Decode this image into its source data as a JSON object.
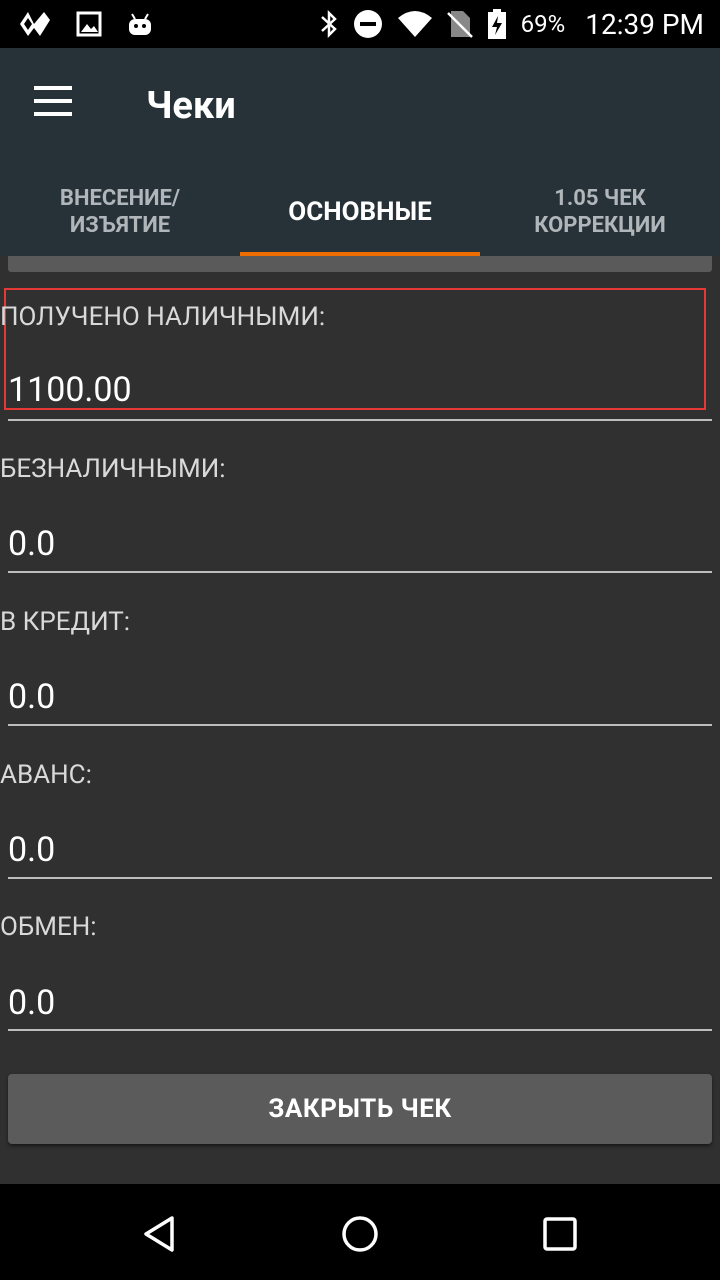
{
  "status_bar": {
    "battery": "69%",
    "time": "12:39 PM",
    "icons": [
      "app-logo-icon",
      "image-icon",
      "android-icon",
      "bluetooth-icon",
      "do-not-disturb-icon",
      "wifi-icon",
      "no-sim-icon",
      "battery-charging-icon"
    ]
  },
  "app_bar": {
    "title": "Чеки",
    "menu_icon": "hamburger-menu-icon"
  },
  "tabs": [
    {
      "label": "ВНЕСЕНИЕ/ ИЗЪЯТИЕ",
      "active": false
    },
    {
      "label": "ОСНОВНЫЕ",
      "active": true
    },
    {
      "label": "1.05 ЧЕК КОРРЕКЦИИ",
      "active": false
    }
  ],
  "fields": [
    {
      "label": "ПОЛУЧЕНО НАЛИЧНЫМИ:",
      "value": "1100.00"
    },
    {
      "label": "БЕЗНАЛИЧНЫМИ:",
      "value": "0.0"
    },
    {
      "label": "В КРЕДИТ:",
      "value": "0.0"
    },
    {
      "label": "АВАНС:",
      "value": "0.0"
    },
    {
      "label": "ОБМЕН:",
      "value": "0.0"
    }
  ],
  "close_button": {
    "label": "ЗАКРЫТЬ ЧЕК"
  },
  "colors": {
    "app_bar": "#263238",
    "tab_indicator": "#ef6c00",
    "background": "#303030",
    "highlight": "#e53935"
  },
  "nav_bar": {
    "icons": [
      "back-icon",
      "home-icon",
      "recents-icon"
    ]
  }
}
